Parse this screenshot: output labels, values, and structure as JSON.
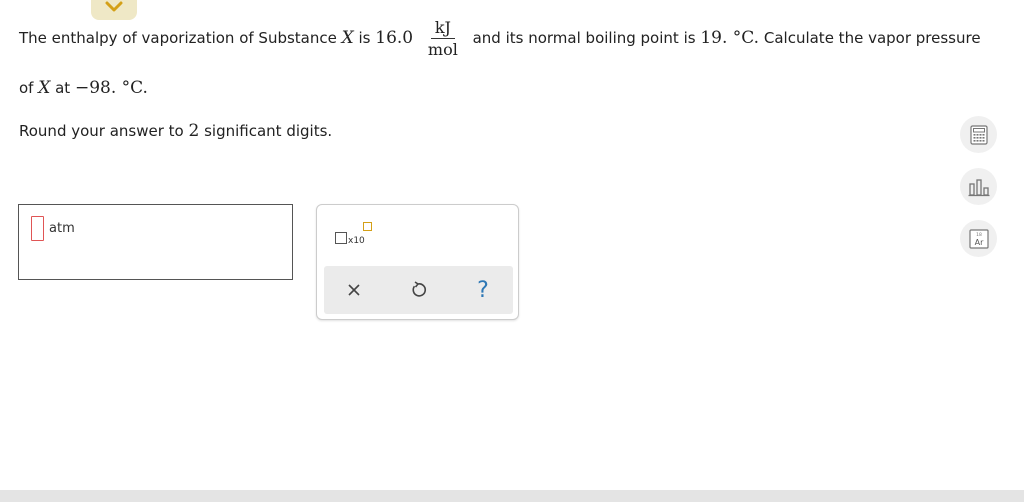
{
  "question": {
    "p1_before_x": "The enthalpy of vaporization of Substance ",
    "var_x": "X",
    "p1_is": " is ",
    "enthalpy_value": "16.0",
    "frac_num": "kJ",
    "frac_den": "mol",
    "p1_after_frac": " and its normal boiling point is ",
    "boiling_point": "19.",
    "deg_c": " °C.",
    "p1_end": " Calculate the vapor pressure",
    "p2_start": "of ",
    "var_x2": "X",
    "p2_at": " at ",
    "temp_value": "−98.",
    "deg_c2": " °C.",
    "round_before": "Round your answer to ",
    "sig_figs": "2",
    "round_after": " significant digits."
  },
  "answer": {
    "unit": "atm"
  },
  "tools": {
    "sci_x10": "x10",
    "help_symbol": "?"
  },
  "sidebar_tools": [
    "calculator-icon",
    "bar-chart-icon",
    "periodic-table-icon"
  ],
  "periodic_icon_text": "Ar",
  "periodic_icon_num": "18",
  "colors": {
    "accent_orange": "#d4a017",
    "input_border": "#e05555",
    "help_blue": "#2d77b5",
    "collapse_bg": "#efe8c6"
  }
}
